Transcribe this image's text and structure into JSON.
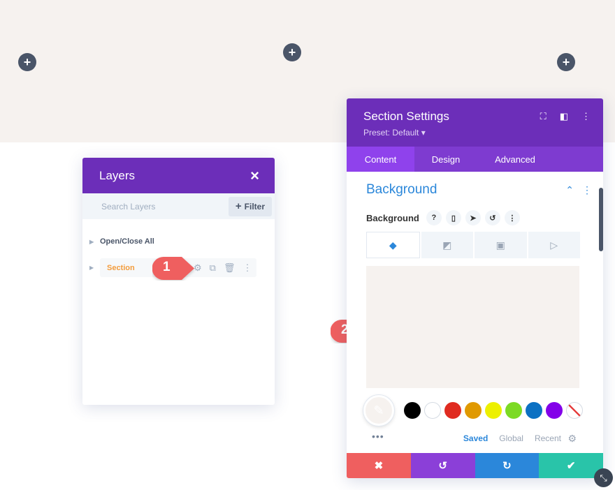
{
  "canvas": {
    "add_buttons": [
      "+",
      "+",
      "+"
    ]
  },
  "layers": {
    "title": "Layers",
    "close_icon": "×",
    "search_placeholder": "Search Layers",
    "filter_label": "Filter",
    "open_close_label": "Open/Close All",
    "section_label": "Section"
  },
  "markers": {
    "one": "1",
    "two": "2"
  },
  "settings": {
    "title": "Section Settings",
    "preset": "Preset: Default ▾",
    "tabs": [
      "Content",
      "Design",
      "Advanced"
    ],
    "toggle_title": "Background",
    "bg_label": "Background",
    "palette_tabs": [
      "Saved",
      "Global",
      "Recent"
    ],
    "dots": "•••"
  },
  "colors": {
    "purple_header": "#6c2eb9",
    "tab_bar": "#7e3bd0",
    "accent_blue": "#2b87da",
    "preview_color": "#f6f2ef",
    "swatches": [
      "#000000",
      "#ffffff",
      "#e02b20",
      "#e09900",
      "#edf000",
      "#7cda24",
      "#0c71c3",
      "#8300e9"
    ],
    "footer": [
      "#ef5f5f",
      "#8b3fd8",
      "#2b87da",
      "#29c4a9"
    ]
  }
}
